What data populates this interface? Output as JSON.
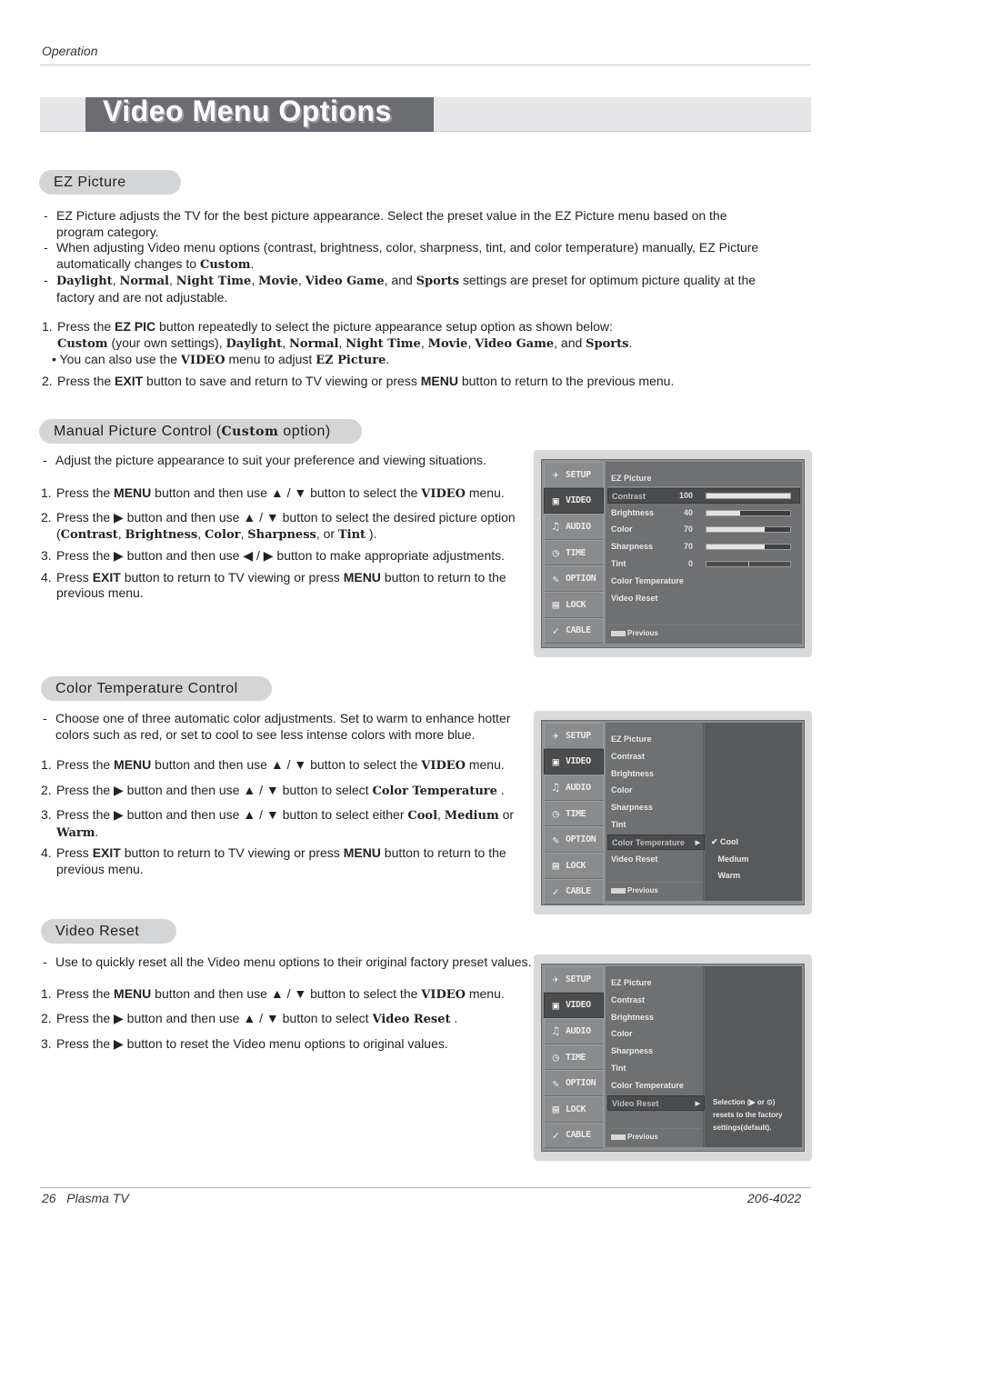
{
  "header": {
    "running_head": "Operation",
    "title": "Video Menu Options"
  },
  "sections": {
    "ez_picture": {
      "heading": "EZ Picture",
      "notes": [
        [
          "",
          "EZ Picture adjusts the TV for the best picture appearance. Select the preset value in the EZ Picture menu based on the program category."
        ],
        [
          "When adjusting Video menu options (contrast, brightness, color, sharpness, tint, and color temperature) manually, EZ Picture automatically changes to ",
          "Custom",
          "."
        ],
        [
          "Daylight",
          ", ",
          "Normal",
          ", ",
          "Night Time",
          ", ",
          "Movie",
          ", ",
          "Video Game",
          ", and ",
          "Sports",
          " settings are preset for optimum picture quality at the factory and are not adjustable."
        ]
      ],
      "step1": {
        "num": "1.",
        "a": "Press the ",
        "b": "EZ PIC",
        "c": " button repeatedly to select the picture appearance setup option as shown below:",
        "opts": [
          "Custom",
          " (your own settings), ",
          "Daylight",
          ", ",
          "Normal",
          ", ",
          "Night Time",
          ", ",
          "Movie",
          ", ",
          "Video Game",
          ", and ",
          "Sports",
          "."
        ],
        "bullet": [
          "• You can also use the ",
          "VIDEO",
          " menu to adjust ",
          "EZ Picture",
          "."
        ]
      },
      "step2": [
        "2.",
        "Press the ",
        "EXIT",
        " button to save and return to TV viewing or press ",
        "MENU",
        " button to return to the previous menu."
      ]
    },
    "manual": {
      "heading_a": "Manual Picture Control (",
      "heading_b": "Custom",
      "heading_c": " option)",
      "note": "Adjust the picture appearance to suit your preference and viewing situations.",
      "steps": [
        [
          "1.",
          "Press the ",
          "MENU",
          " button and then use ▲ / ▼  button to select the ",
          "VIDEO",
          " menu."
        ],
        [
          "2.",
          "Press the ▶ button and then use ▲ / ▼ button to select the desired picture option (",
          "Contrast",
          ", ",
          "Brightness",
          ", ",
          "Color",
          ", ",
          "Sharpness",
          ", or ",
          "Tint",
          " )."
        ],
        [
          "3.",
          "Press the ▶ button and then use ◀ / ▶ button to make appropriate adjustments."
        ],
        [
          "4.",
          "Press ",
          "EXIT",
          " button to return to TV viewing or press ",
          "MENU",
          " button to return to the previous menu."
        ]
      ]
    },
    "color_temp": {
      "heading": "Color Temperature Control",
      "note": "Choose one of three automatic color adjustments. Set to warm to enhance hotter colors such as red, or set to cool to see less intense colors with more blue.",
      "steps": [
        [
          "1.",
          "Press the ",
          "MENU",
          " button and then use ▲ / ▼  button to select the ",
          "VIDEO",
          " menu."
        ],
        [
          "2.",
          "Press the ▶  button and then use ▲ / ▼ button to select ",
          "Color Temperature",
          " ."
        ],
        [
          "3.",
          "Press the ▶  button and then use ▲ / ▼ button to select either ",
          "Cool",
          ", ",
          "Medium",
          " or ",
          "Warm",
          "."
        ],
        [
          "4.",
          "Press ",
          "EXIT",
          " button to return to TV viewing or press ",
          "MENU",
          " button to return to the previous menu."
        ]
      ]
    },
    "video_reset": {
      "heading": "Video Reset",
      "note": "Use to quickly reset all the Video menu options to their original factory preset values.",
      "steps": [
        [
          "1.",
          "Press the ",
          "MENU",
          " button and then use ▲ / ▼  button to select the ",
          "VIDEO",
          " menu."
        ],
        [
          "2.",
          "Press the ▶  button and then use ▲ / ▼ button to select ",
          "Video Reset",
          " ."
        ],
        [
          "3.",
          "Press the ▶  button to reset the Video menu options to original values."
        ]
      ]
    }
  },
  "tv_menu": {
    "sidebar": [
      {
        "label": "SETUP",
        "icon": "satellite-dish"
      },
      {
        "label": "VIDEO",
        "icon": "monitor"
      },
      {
        "label": "AUDIO",
        "icon": "speaker"
      },
      {
        "label": "TIME",
        "icon": "clock"
      },
      {
        "label": "OPTION",
        "icon": "wrench"
      },
      {
        "label": "LOCK",
        "icon": "padlock"
      },
      {
        "label": "CABLE",
        "icon": "cable-plug"
      }
    ],
    "active_sidebar": "VIDEO",
    "items": [
      "EZ Picture",
      "Contrast",
      "Brightness",
      "Color",
      "Sharpness",
      "Tint",
      "Color Temperature",
      "Video Reset"
    ],
    "previous_label": "Previous",
    "screen1": {
      "selected": "Contrast",
      "values": {
        "Contrast": 100,
        "Brightness": 40,
        "Color": 70,
        "Sharpness": 70,
        "Tint": 0
      },
      "ranges": {
        "Contrast": [
          0,
          100
        ],
        "Brightness": [
          0,
          100
        ],
        "Color": [
          0,
          100
        ],
        "Sharpness": [
          0,
          100
        ],
        "Tint": [
          -50,
          50
        ]
      }
    },
    "screen2": {
      "selected": "Color Temperature",
      "options": [
        "Cool",
        "Medium",
        "Warm"
      ],
      "checked": "Cool"
    },
    "screen3": {
      "selected": "Video Reset",
      "help": [
        "Selection (▶ or ⊙)",
        "resets to the factory",
        "settings(default)."
      ]
    }
  },
  "footer": {
    "left": "26   Plasma TV",
    "right": "206-4022"
  }
}
